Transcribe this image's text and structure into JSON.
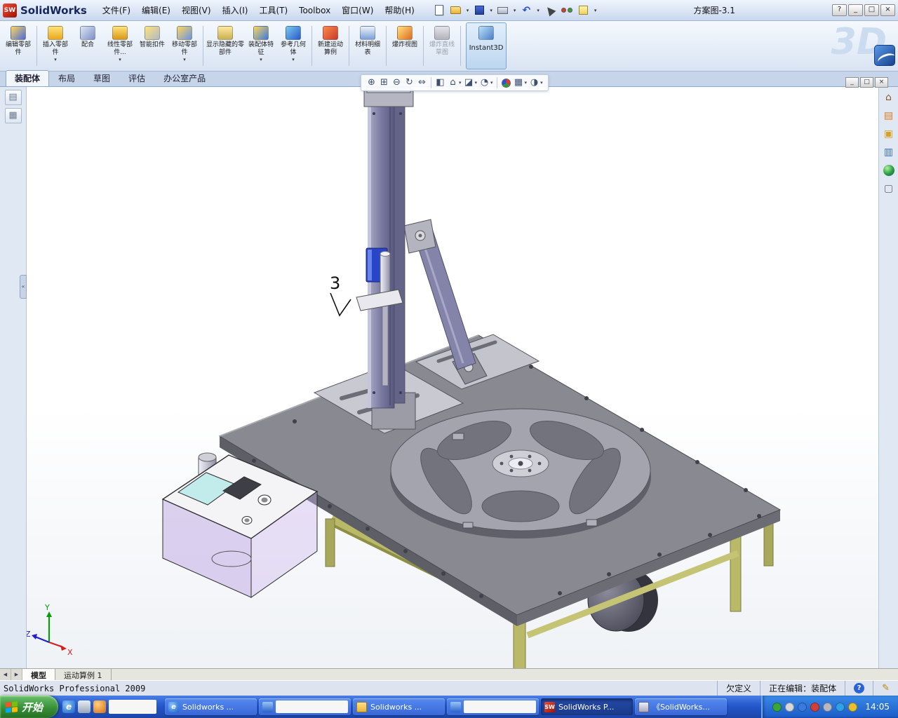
{
  "titlebar": {
    "logo_text": "SW",
    "app_name": "SolidWorks",
    "menus": [
      "文件(F)",
      "编辑(E)",
      "视图(V)",
      "插入(I)",
      "工具(T)",
      "Toolbox",
      "窗口(W)",
      "帮助(H)"
    ],
    "document_title": "方案图-3.1",
    "help_label": "?",
    "minimize_glyph": "_",
    "restore_glyph": "□",
    "close_glyph": "×"
  },
  "command_manager": {
    "buttons": [
      {
        "label": "编辑零部件"
      },
      {
        "label": "插入零部件",
        "arrow": "▾"
      },
      {
        "label": "配合"
      },
      {
        "label": "线性零部件...",
        "arrow": "▾"
      },
      {
        "label": "智能扣件"
      },
      {
        "label": "移动零部件",
        "arrow": "▾"
      },
      {
        "label": "显示隐藏的零部件"
      },
      {
        "label": "装配体特征",
        "arrow": "▾"
      },
      {
        "label": "参考几何体",
        "arrow": "▾"
      },
      {
        "label": "新建运动算例"
      },
      {
        "label": "材料明细表"
      },
      {
        "label": "爆炸视图"
      },
      {
        "label": "爆炸直线草图"
      }
    ],
    "instant3d_label": "Instant3D",
    "brand_text": "3D"
  },
  "ribbon_tabs": [
    {
      "label": "装配体"
    },
    {
      "label": "布局"
    },
    {
      "label": "草图"
    },
    {
      "label": "评估"
    },
    {
      "label": "办公室产品"
    }
  ],
  "view_toolbar": {
    "zoom_fit": "⊕",
    "zoom_area": "⊞",
    "zoom_inout": "⊖",
    "rotate": "↻",
    "pan": "⇔",
    "section": "◧",
    "orientation": "⌂",
    "display_style": "◪",
    "hide_show": "◔",
    "scene": "▦",
    "settings": "◑",
    "arrow": "▾"
  },
  "doc_window": {
    "minimize": "_",
    "restore": "□",
    "close": "×"
  },
  "left_pane": {
    "filter_glyph": "▤",
    "display_glyph": "▦",
    "splitter_glyph": "«"
  },
  "task_pane": {
    "resources": "⌂",
    "library": "▤",
    "palette": "▥",
    "explorer": "▣",
    "properties": "▢"
  },
  "viewport": {
    "annotation_label": "3",
    "triad": {
      "x_label": "X",
      "y_label": "Y",
      "z_label": "Z"
    }
  },
  "model_tabs": {
    "nav_prev": "◀",
    "nav_next": "▶",
    "tabs": [
      {
        "label": "模型"
      },
      {
        "label": "运动算例 1"
      }
    ]
  },
  "statusbar": {
    "product": "SolidWorks Professional 2009",
    "constraint_status": "欠定义",
    "editing_status": "正在编辑：装配体",
    "help_glyph": "?",
    "edit_glyph": "✎"
  },
  "taskbar": {
    "start_label": "开始",
    "quick_launch_ie": "e",
    "tasks": [
      {
        "label": "Solidworks ..."
      },
      {
        "label": ""
      },
      {
        "label": "Solidworks ..."
      },
      {
        "label": ""
      },
      {
        "label": "SolidWorks P..."
      },
      {
        "label": "《SolidWorks..."
      }
    ],
    "sw_badge": "SW",
    "clock": "14:05"
  }
}
